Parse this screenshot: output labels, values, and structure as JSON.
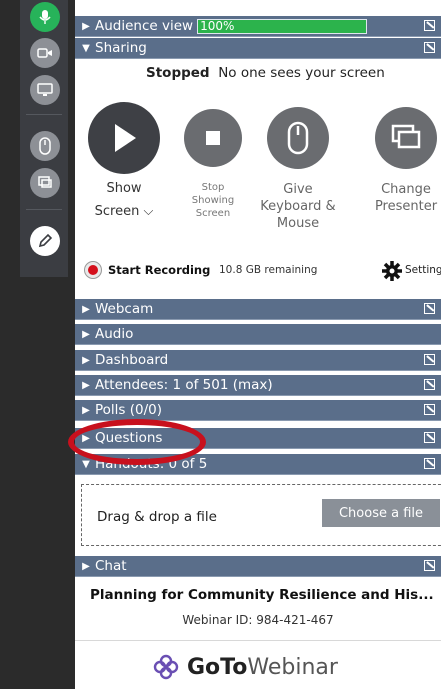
{
  "toolbar": {
    "icons": [
      "microphone-icon",
      "webcam-icon",
      "screen-share-icon",
      "mouse-icon",
      "presenter-icon",
      "pen-icon"
    ],
    "colors": {
      "active": "#27b35a",
      "inactive": "#8d9096"
    }
  },
  "audience_view": {
    "label": "Audience view",
    "zoom": "100%"
  },
  "sharing": {
    "label": "Sharing",
    "status_bold": "Stopped",
    "status_text": "No one sees your screen",
    "show_label": "Show",
    "show_select": "Screen",
    "stop_line1": "Stop",
    "stop_line2": "Showing",
    "stop_line3": "Screen",
    "give_line1": "Give",
    "give_line2": "Keyboard &",
    "give_line3": "Mouse",
    "change_line1": "Change",
    "change_line2": "Presenter"
  },
  "recording": {
    "label": "Start Recording",
    "remaining": "10.8 GB remaining",
    "settings": "Settings"
  },
  "sections": {
    "webcam": "Webcam",
    "audio": "Audio",
    "dashboard": "Dashboard",
    "attendees": "Attendees: 1 of 501 (max)",
    "polls": "Polls (0/0)",
    "questions": "Questions",
    "handouts": "Handouts: 0 of 5",
    "chat": "Chat"
  },
  "handouts": {
    "drop_text": "Drag & drop a file",
    "choose_button": "Choose a file"
  },
  "webinar": {
    "title": "Planning for Community Resilience and His...",
    "id": "Webinar ID: 984-421-467"
  },
  "brand": {
    "goto": "GoTo",
    "webinar": "Webinar"
  },
  "colors": {
    "bar": "#5a6e8a",
    "meter": "#2cb34c",
    "record": "#d40f1b",
    "highlight": "#c8101d"
  }
}
